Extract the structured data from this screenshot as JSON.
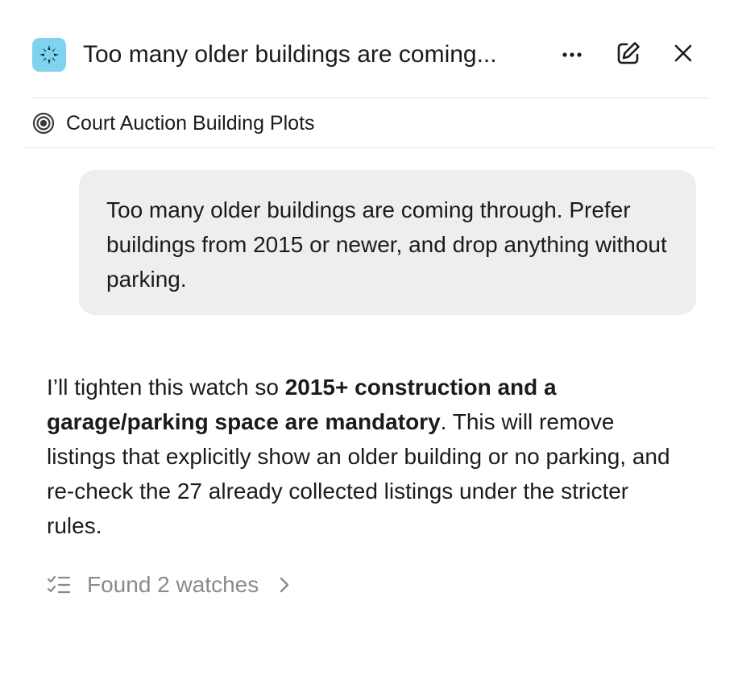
{
  "header": {
    "title": "Too many older buildings are coming...",
    "app_icon": "sparkle-burst-icon",
    "more_icon": "more-horizontal-icon",
    "edit_icon": "edit-square-icon",
    "close_icon": "close-icon",
    "app_icon_color": "#7fd3ee"
  },
  "project": {
    "icon": "target-icon",
    "name": "Court Auction Building Plots"
  },
  "conversation": {
    "user_message": "Too many older buildings are coming through. Prefer buildings from 2015 or newer, and drop anything without parking.",
    "assistant": {
      "part1": "I’ll tighten this watch so ",
      "bold": "2015+ construction and a garage/parking space are mandatory",
      "part2": ". This will remove listings that explicitly show an older building or no parking, and re-check the 27 already collected listings under the stricter rules."
    },
    "tool_result": {
      "icon": "checklist-icon",
      "label": "Found 2 watches",
      "chevron_icon": "chevron-right-icon"
    }
  },
  "colors": {
    "user_bubble": "#eeeeee",
    "muted_text": "#8a8a8a",
    "divider": "#e6e6e6"
  }
}
